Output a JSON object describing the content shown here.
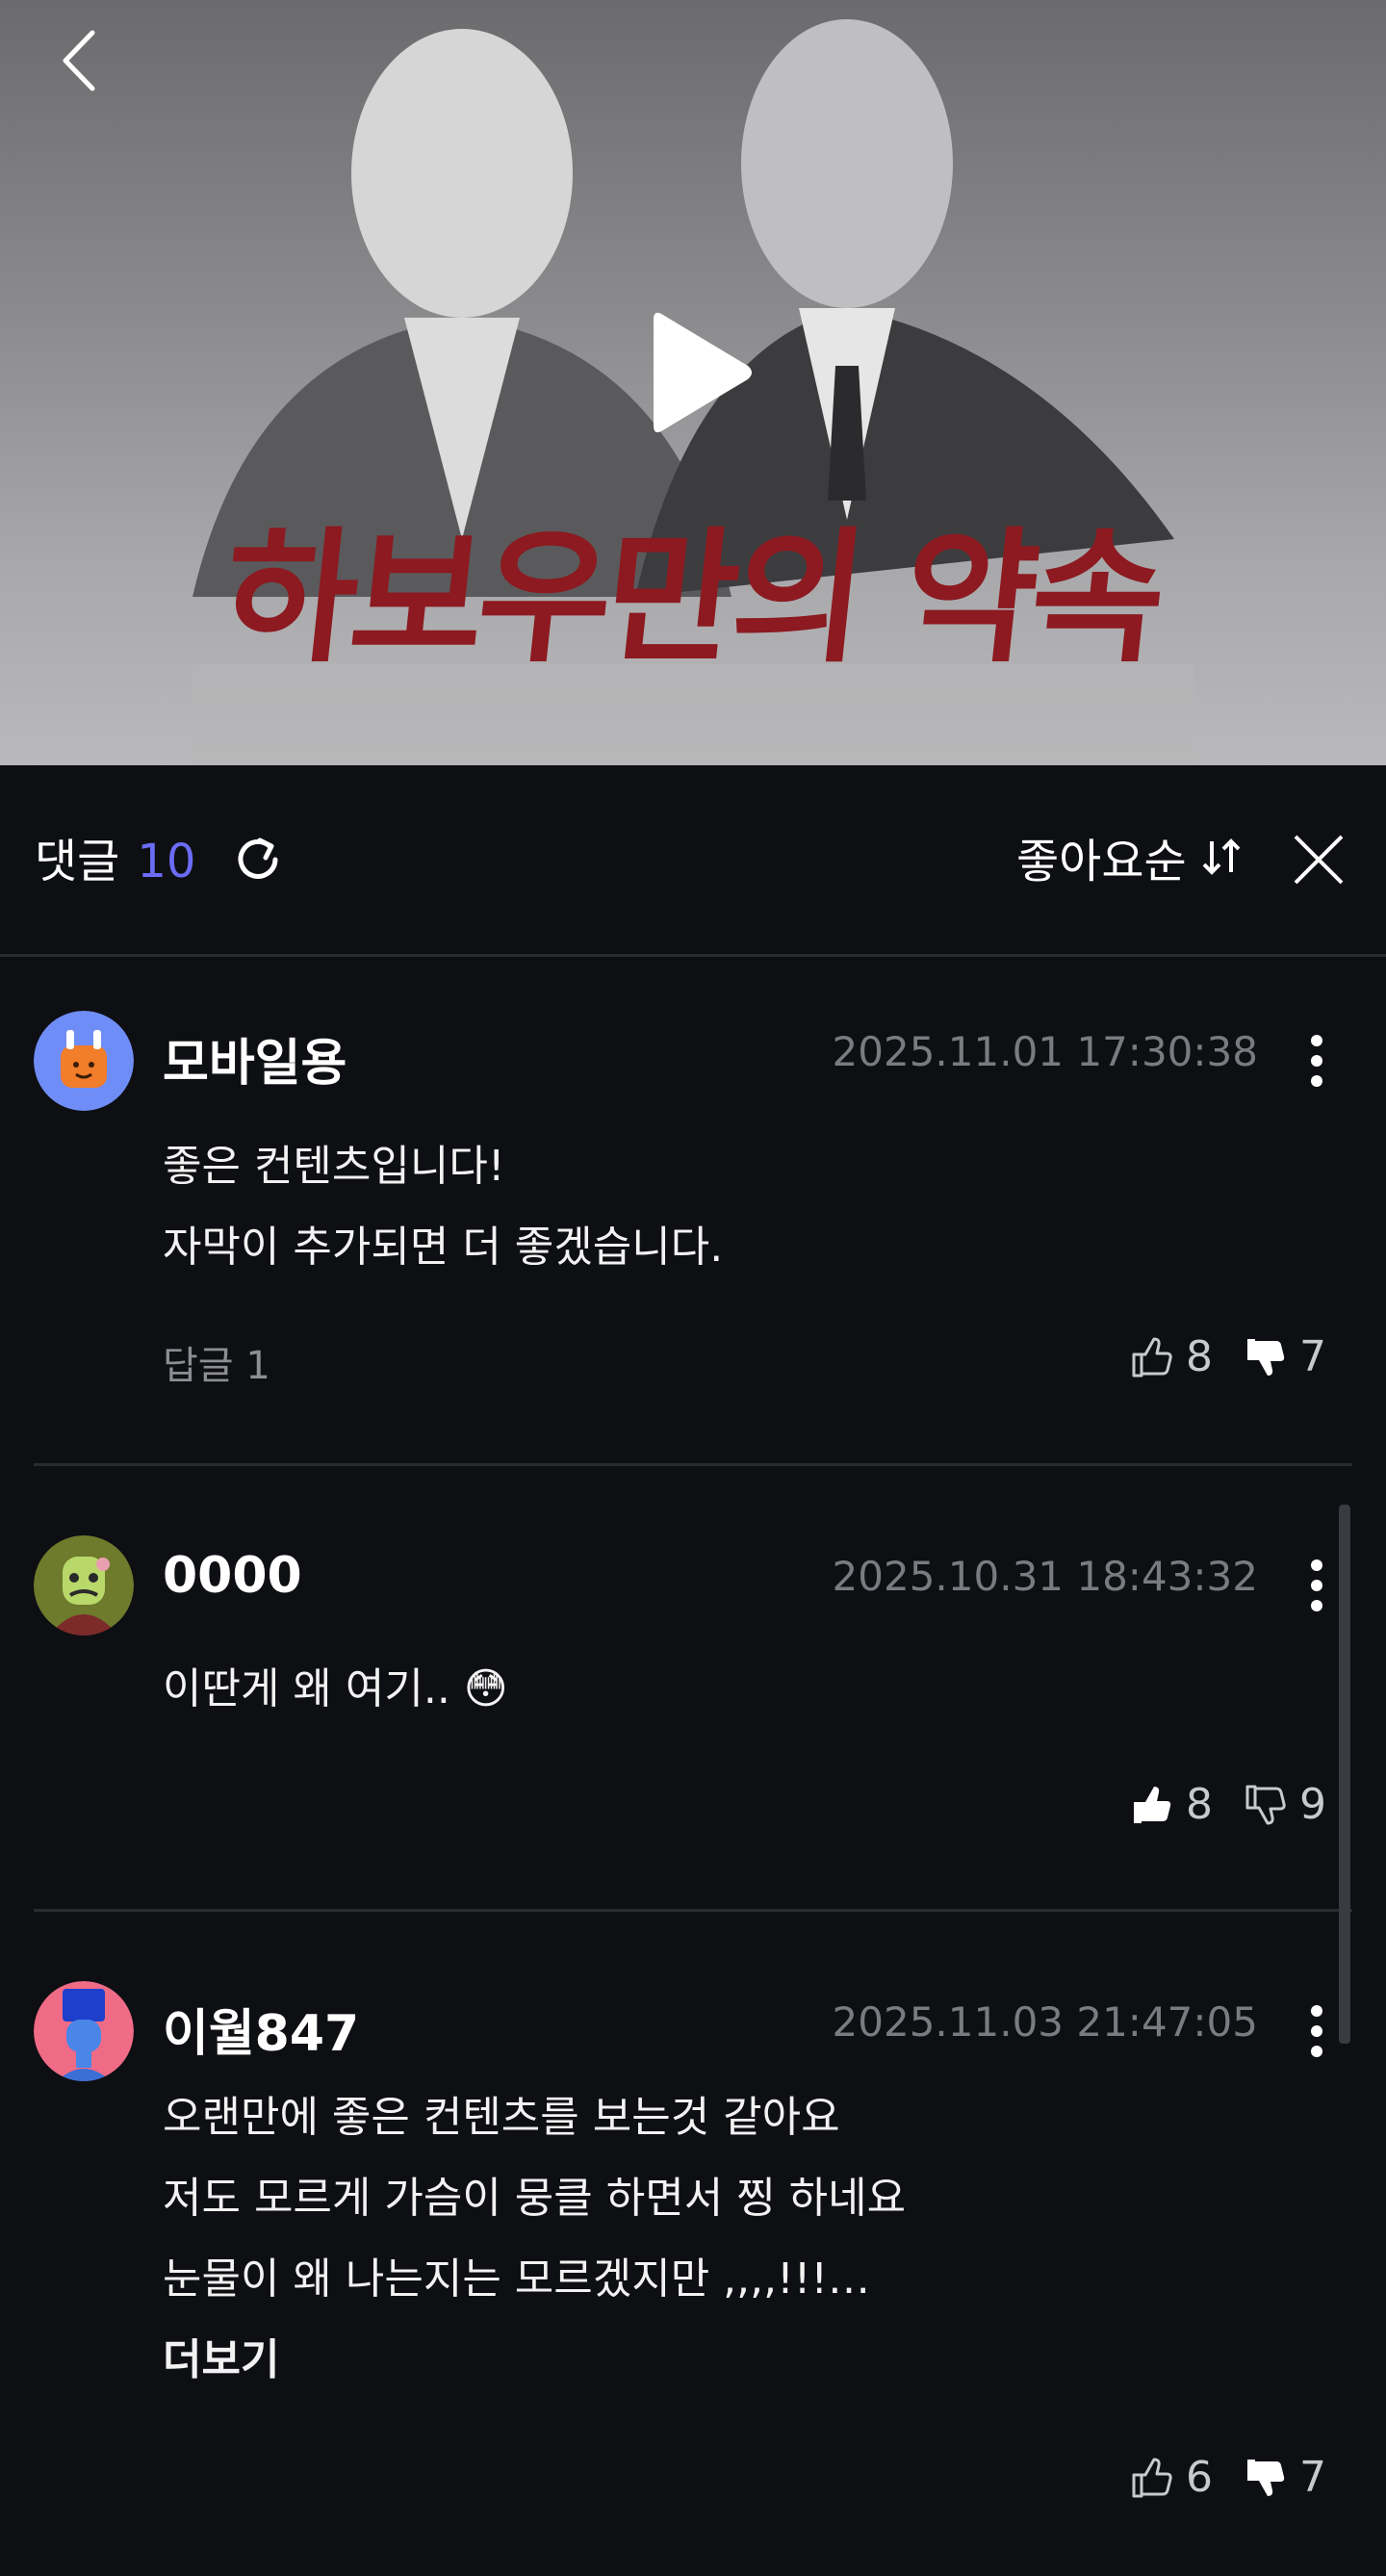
{
  "video": {
    "title_art": "하보우만의 약속"
  },
  "comments_header": {
    "label": "댓글",
    "count": "10",
    "sort_label": "좋아요순"
  },
  "comments": [
    {
      "name": "모바일용",
      "date": "2025.11.01 17:30:38",
      "lines": [
        "좋은 컨텐츠입니다!",
        "자막이 추가되면 더 좋겠습니다."
      ],
      "replies": "답글 1",
      "likes": "8",
      "dislikes": "7",
      "liked": false,
      "disliked": true
    },
    {
      "name": "0000",
      "date": "2025.10.31 18:43:32",
      "lines": [
        "이딴게 왜 여기.. 😳"
      ],
      "likes": "8",
      "dislikes": "9",
      "liked": true,
      "disliked": false
    },
    {
      "name": "이월847",
      "date": "2025.11.03 21:47:05",
      "lines": [
        "오랜만에 좋은 컨텐츠를 보는것 같아요",
        "저도 모르게 가슴이 뭉클 하면서 찡 하네요",
        "눈물이 왜 나는지는  모르겠지만  ,,,,!!!…"
      ],
      "read_more": "더보기",
      "likes": "6",
      "dislikes": "7",
      "liked": false,
      "disliked": true
    }
  ],
  "colors": {
    "background": "#0e0f13",
    "accent_count": "#6b6cf6",
    "divider": "#2a2b30",
    "date": "#7a7b80"
  }
}
